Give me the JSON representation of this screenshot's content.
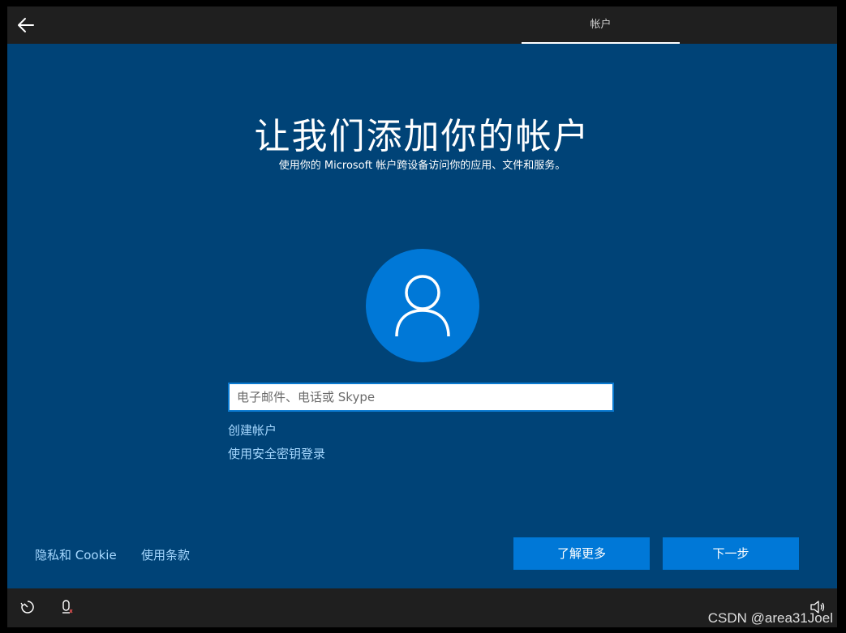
{
  "header": {
    "tab_label": "帐户"
  },
  "main": {
    "title": "让我们添加你的帐户",
    "subtitle": "使用你的 Microsoft 帐户跨设备访问你的应用、文件和服务。",
    "email_placeholder": "电子邮件、电话或 Skype",
    "create_account_link": "创建帐户",
    "security_key_link": "使用安全密钥登录"
  },
  "footer": {
    "privacy_link": "隐私和 Cookie",
    "terms_link": "使用条款",
    "learn_more_button": "了解更多",
    "next_button": "下一步"
  },
  "watermark": "CSDN @area31Joel",
  "colors": {
    "background": "#004377",
    "accent": "#0078d7",
    "bar": "#1f1f1f",
    "link": "#a6d8ff"
  },
  "icons": {
    "back": "back-arrow-icon",
    "avatar": "user-icon",
    "accessibility": "accessibility-icon",
    "microphone": "microphone-icon",
    "volume": "volume-icon"
  }
}
